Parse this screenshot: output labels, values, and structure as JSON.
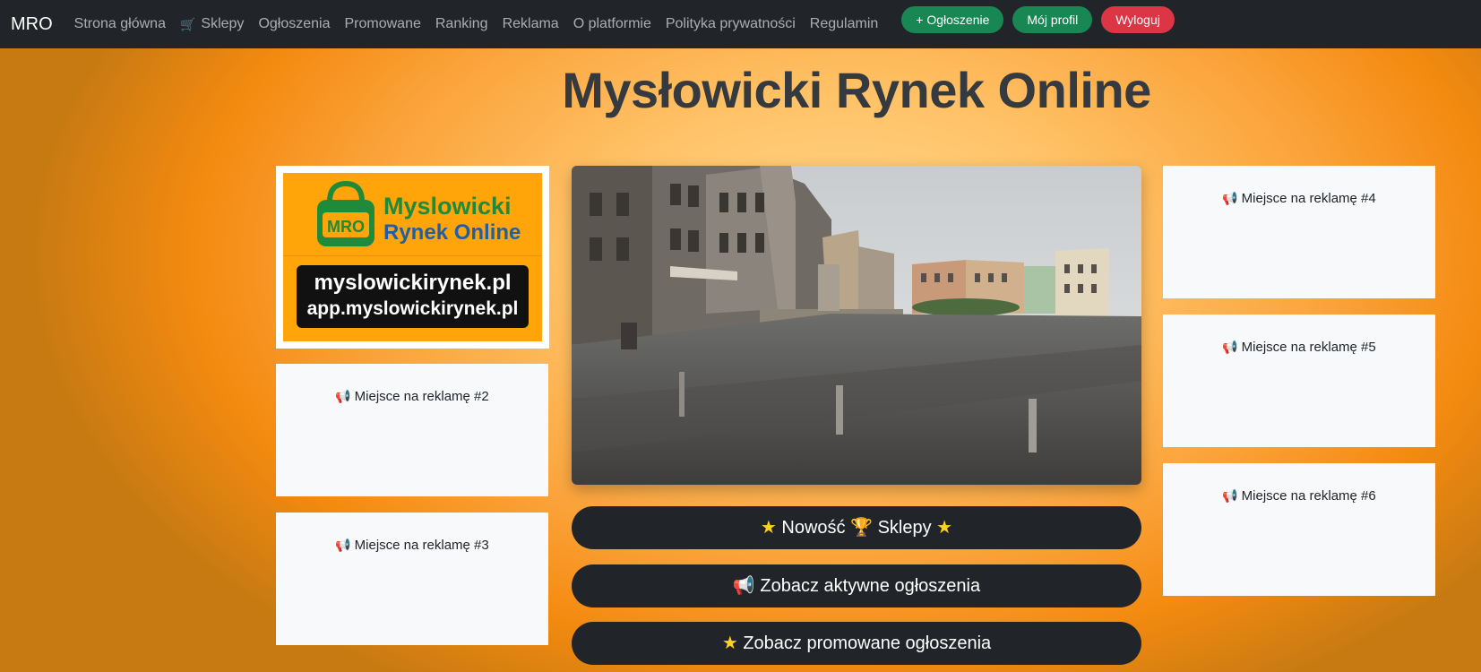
{
  "nav": {
    "brand": "MRO",
    "links": [
      "Strona główna",
      "Sklepy",
      "Ogłoszenia",
      "Promowane",
      "Ranking",
      "Reklama",
      "O platformie",
      "Polityka prywatności",
      "Regulamin"
    ],
    "add_button": "+ Ogłoszenie",
    "profile_button": "Mój profil",
    "logout_button": "Wyloguj"
  },
  "title": "Mysłowicki Rynek Online",
  "logo": {
    "badge": "MRO",
    "line1": "Myslowicki",
    "line2": "Rynek Online",
    "url1": "myslowickirynek.pl",
    "url2": "app.myslowickirynek.pl"
  },
  "ads": {
    "ad2": "Miejsce na reklamę #2",
    "ad3": "Miejsce na reklamę #3",
    "ad4": "Miejsce na reklamę #4",
    "ad5": "Miejsce na reklamę #5",
    "ad6": "Miejsce na reklamę #6"
  },
  "buttons": {
    "new_shops_a": "Nowość",
    "new_shops_b": "Sklepy",
    "active_listings": "Zobacz aktywne ogłoszenia",
    "promoted_listings": "Zobacz promowane ogłoszenia"
  },
  "colors": {
    "navbar": "#212529",
    "green": "#198754",
    "red": "#dc3545",
    "background_orange": "#f48a10"
  },
  "icons": [
    "cart-icon",
    "megaphone-icon",
    "star-icon",
    "trophy-icon"
  ]
}
